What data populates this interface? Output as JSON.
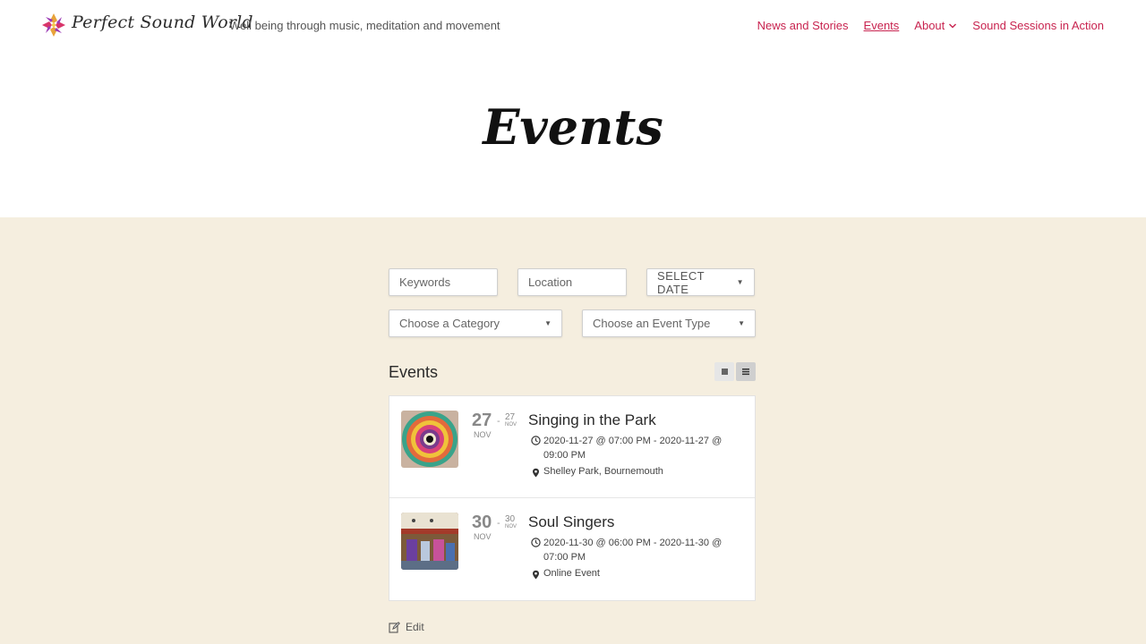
{
  "header": {
    "brand": "Perfect Sound World",
    "tagline": "Well being through music, meditation and movement",
    "nav": [
      {
        "label": "News and Stories"
      },
      {
        "label": "Events"
      },
      {
        "label": "About"
      },
      {
        "label": "Sound Sessions in Action"
      }
    ],
    "accent_color": "#c8234f"
  },
  "hero": {
    "title": "Events"
  },
  "filters": {
    "keywords_placeholder": "Keywords",
    "location_placeholder": "Location",
    "date_label": "SELECT DATE",
    "category_label": "Choose a Category",
    "event_type_label": "Choose an Event Type"
  },
  "events_section": {
    "title": "Events",
    "events": [
      {
        "start_day": "27",
        "start_month": "NOV",
        "end_day": "27",
        "end_month": "NOV",
        "title": "Singing in the Park",
        "time": "2020-11-27 @ 07:00 PM - 2020-11-27 @ 09:00 PM",
        "location": "Shelley Park, Bournemouth",
        "thumb_icon": "mandala-image"
      },
      {
        "start_day": "30",
        "start_month": "NOV",
        "end_day": "30",
        "end_month": "NOV",
        "title": "Soul Singers",
        "time": "2020-11-30 @ 06:00 PM - 2020-11-30 @ 07:00 PM",
        "location": "Online Event",
        "thumb_icon": "group-photo-image"
      }
    ]
  },
  "footer": {
    "edit_label": "Edit"
  },
  "colors": {
    "band_background": "#f5eedf"
  }
}
